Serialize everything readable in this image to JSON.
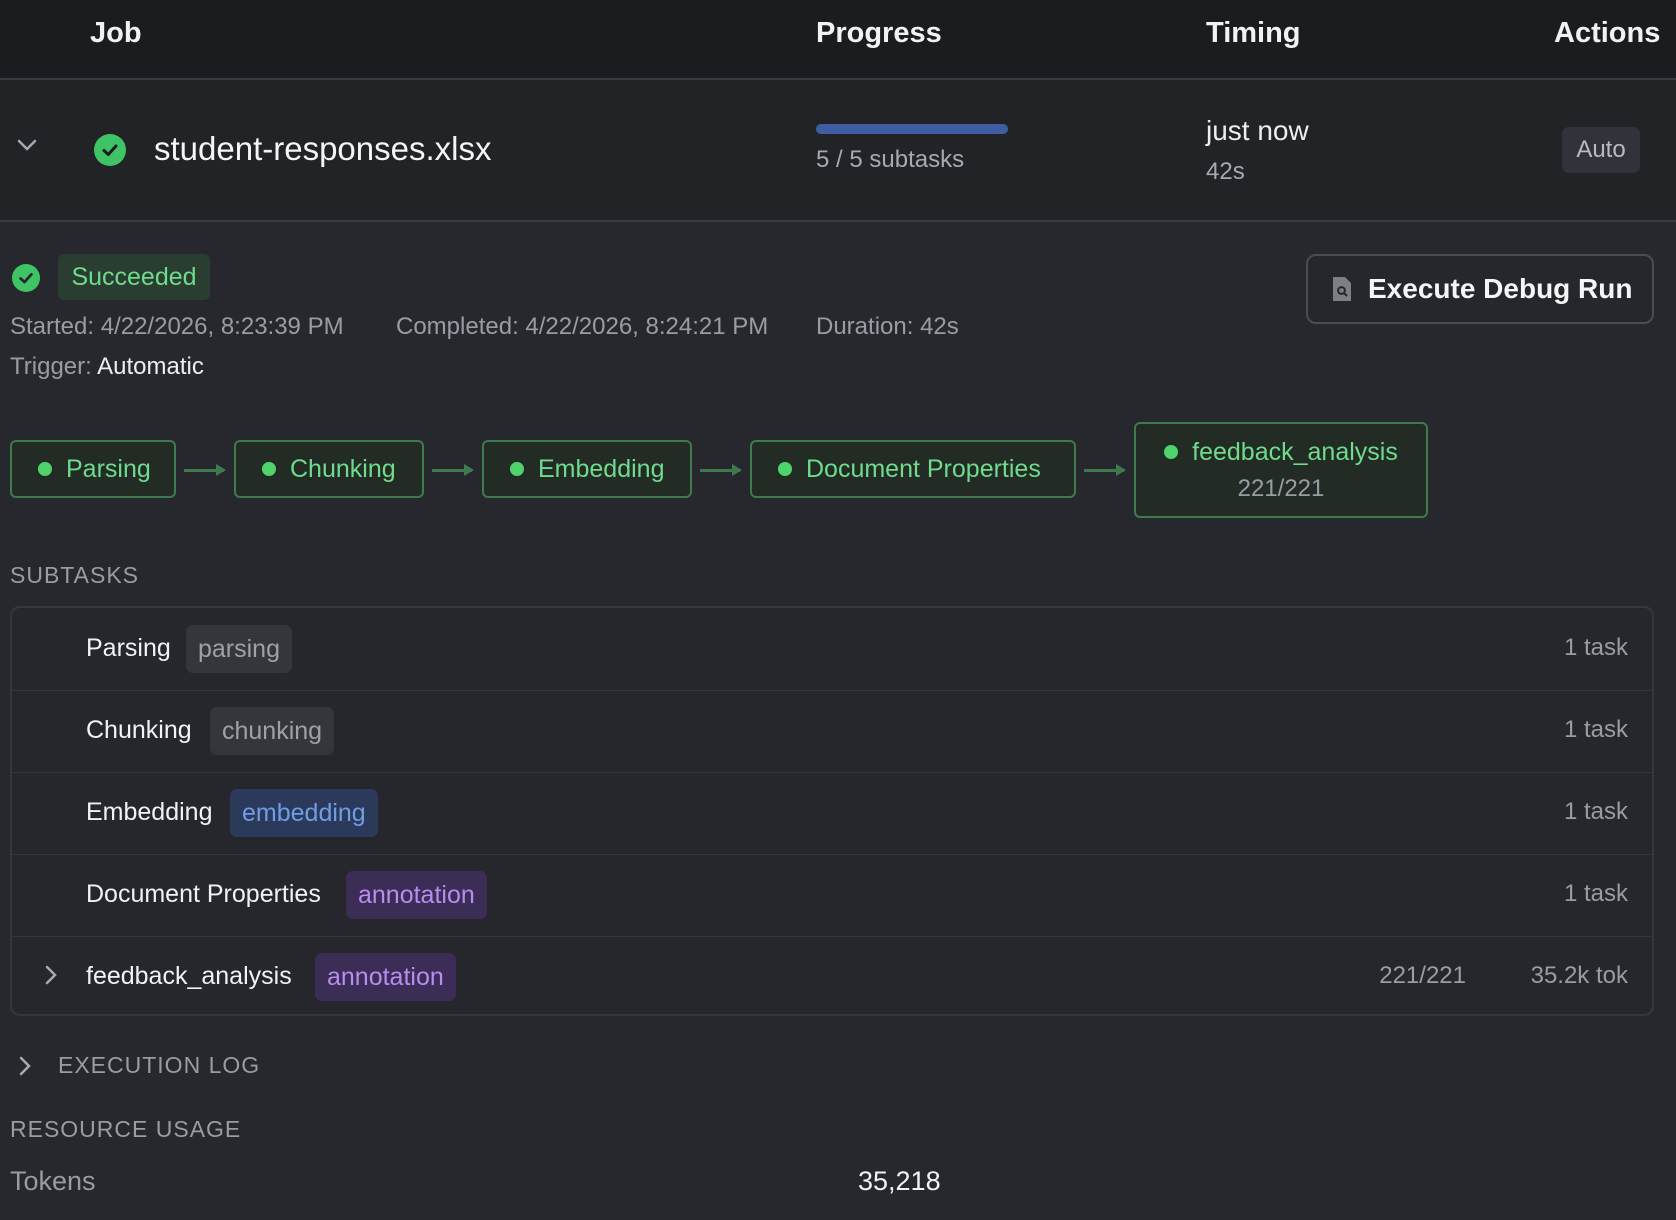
{
  "header": {
    "job": "Job",
    "progress": "Progress",
    "timing": "Timing",
    "actions": "Actions"
  },
  "job": {
    "filename": "student-responses.xlsx",
    "progress_fraction": 1.0,
    "progress_text": "5 / 5 subtasks",
    "timing_primary": "just now",
    "timing_secondary": "42s",
    "action_label": "Auto"
  },
  "detail": {
    "status": "Succeeded",
    "started_label": "Started:",
    "started": "4/22/2026, 8:23:39 PM",
    "completed_label": "Completed:",
    "completed": "4/22/2026, 8:24:21 PM",
    "duration_label": "Duration:",
    "duration": "42s",
    "trigger_label": "Trigger:",
    "trigger": "Automatic",
    "debug_button": "Execute Debug Run"
  },
  "pipeline": [
    {
      "label": "Parsing"
    },
    {
      "label": "Chunking"
    },
    {
      "label": "Embedding"
    },
    {
      "label": "Document Properties"
    },
    {
      "label": "feedback_analysis",
      "sub": "221/221"
    }
  ],
  "subtasks_title": "SUBTASKS",
  "subtasks": [
    {
      "name": "Parsing",
      "tag": "parsing",
      "count": "1 task"
    },
    {
      "name": "Chunking",
      "tag": "chunking",
      "count": "1 task"
    },
    {
      "name": "Embedding",
      "tag": "embedding",
      "count": "1 task"
    },
    {
      "name": "Document Properties",
      "tag": "annotation",
      "count": "1 task"
    },
    {
      "name": "feedback_analysis",
      "tag": "annotation",
      "count": "221/221",
      "tokens": "35.2k tok"
    }
  ],
  "execution_log_title": "EXECUTION LOG",
  "resource_usage_title": "RESOURCE USAGE",
  "resources": {
    "tokens_label": "Tokens",
    "tokens_value": "35,218"
  },
  "colors": {
    "success": "#3ec465",
    "progress": "#3e5da3",
    "stage_border": "#3f7a4e"
  }
}
